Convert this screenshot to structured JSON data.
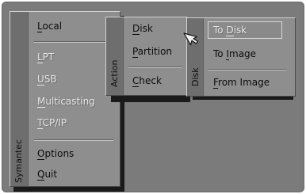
{
  "main_menu": {
    "title": "Symantec",
    "items": [
      {
        "pre": "",
        "key": "L",
        "post": "ocal",
        "enabled": true
      },
      {
        "pre": "",
        "key": "L",
        "post": "PT",
        "enabled": false
      },
      {
        "pre": "",
        "key": "U",
        "post": "SB",
        "enabled": false
      },
      {
        "pre": "",
        "key": "M",
        "post": "ulticasting",
        "enabled": false
      },
      {
        "pre": "",
        "key": "T",
        "post": "CP/IP",
        "enabled": false
      },
      {
        "pre": "",
        "key": "O",
        "post": "ptions",
        "enabled": true
      },
      {
        "pre": "",
        "key": "Q",
        "post": "uit",
        "enabled": true
      }
    ]
  },
  "action_menu": {
    "title": "Action",
    "items": [
      {
        "pre": "",
        "key": "D",
        "post": "isk",
        "enabled": true
      },
      {
        "pre": "",
        "key": "P",
        "post": "artition",
        "enabled": true
      },
      {
        "pre": "",
        "key": "C",
        "post": "heck",
        "enabled": true
      }
    ]
  },
  "disk_menu": {
    "title": "Disk",
    "items": [
      {
        "pre": "To ",
        "key": "D",
        "post": "isk",
        "enabled": false
      },
      {
        "pre": "To ",
        "key": "I",
        "post": "mage",
        "enabled": true
      },
      {
        "pre": "",
        "key": "F",
        "post": "rom Image",
        "enabled": true
      }
    ]
  }
}
